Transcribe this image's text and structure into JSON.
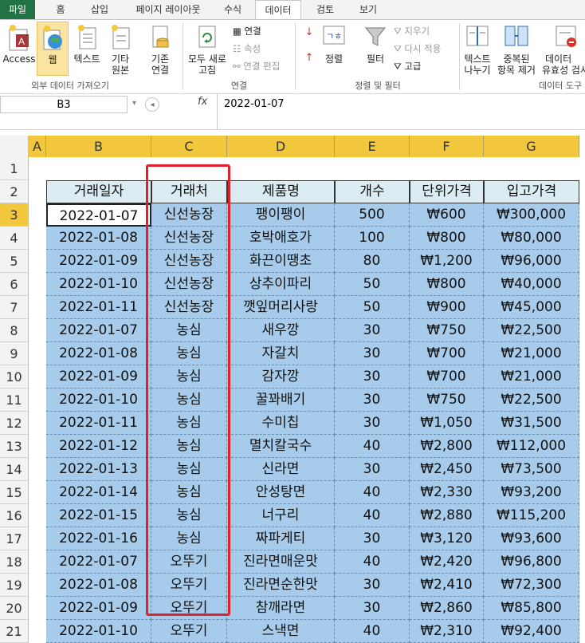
{
  "tabs": [
    "파일",
    "홈",
    "삽입",
    "페이지 레이아웃",
    "수식",
    "데이터",
    "검토",
    "보기"
  ],
  "ribbon": {
    "access": "Access",
    "web": "웹",
    "text": "텍스트",
    "other_line1": "기타",
    "other_line2": "원본",
    "existing_line1": "기존",
    "existing_line2": "연결",
    "group_external": "외부 데이터 가져오기",
    "refresh_line1": "모두 새로",
    "refresh_line2": "고침",
    "connections": "연결",
    "properties": "속성",
    "edit_links": "연결 편집",
    "group_connections": "연결",
    "sort": "정렬",
    "filter": "필터",
    "clear": "지우기",
    "reapply": "다시 적용",
    "advanced": "고급",
    "group_sort": "정렬 및 필터",
    "text_to_col_line1": "텍스트",
    "text_to_col_line2": "나누기",
    "remove_dup_line1": "중복된",
    "remove_dup_line2": "항목 제거",
    "validation_line1": "데이터",
    "validation_line2": "유효성 검사",
    "group_tools": "데이터 도구"
  },
  "formula_bar": {
    "name_box": "B3",
    "fx": "fx",
    "value": "2022-01-07"
  },
  "columns": [
    "A",
    "B",
    "C",
    "D",
    "E",
    "F",
    "G"
  ],
  "row_numbers": [
    "1",
    "2",
    "3",
    "4",
    "5",
    "6",
    "7",
    "8",
    "9",
    "10",
    "11",
    "12",
    "13",
    "14",
    "15",
    "16",
    "17",
    "18",
    "19",
    "20",
    "21"
  ],
  "headers": [
    "거래일자",
    "거래처",
    "제품명",
    "개수",
    "단위가격",
    "입고가격"
  ],
  "rows": [
    [
      "2022-01-07",
      "신선농장",
      "팽이팽이",
      "500",
      "₩600",
      "₩300,000"
    ],
    [
      "2022-01-08",
      "신선농장",
      "호박애호가",
      "100",
      "₩800",
      "₩80,000"
    ],
    [
      "2022-01-09",
      "신선농장",
      "화끈이땡초",
      "80",
      "₩1,200",
      "₩96,000"
    ],
    [
      "2022-01-10",
      "신선농장",
      "상추이파리",
      "50",
      "₩800",
      "₩40,000"
    ],
    [
      "2022-01-11",
      "신선농장",
      "깻잎머리사랑",
      "50",
      "₩900",
      "₩45,000"
    ],
    [
      "2022-01-07",
      "농심",
      "새우깡",
      "30",
      "₩750",
      "₩22,500"
    ],
    [
      "2022-01-08",
      "농심",
      "자갈치",
      "30",
      "₩700",
      "₩21,000"
    ],
    [
      "2022-01-09",
      "농심",
      "감자깡",
      "30",
      "₩700",
      "₩21,000"
    ],
    [
      "2022-01-10",
      "농심",
      "꿀꽈배기",
      "30",
      "₩750",
      "₩22,500"
    ],
    [
      "2022-01-11",
      "농심",
      "수미칩",
      "30",
      "₩1,050",
      "₩31,500"
    ],
    [
      "2022-01-12",
      "농심",
      "멸치칼국수",
      "40",
      "₩2,800",
      "₩112,000"
    ],
    [
      "2022-01-13",
      "농심",
      "신라면",
      "30",
      "₩2,450",
      "₩73,500"
    ],
    [
      "2022-01-14",
      "농심",
      "안성탕면",
      "40",
      "₩2,330",
      "₩93,200"
    ],
    [
      "2022-01-15",
      "농심",
      "너구리",
      "40",
      "₩2,880",
      "₩115,200"
    ],
    [
      "2022-01-16",
      "농심",
      "짜파게티",
      "30",
      "₩3,120",
      "₩93,600"
    ],
    [
      "2022-01-07",
      "오뚜기",
      "진라면매운맛",
      "40",
      "₩2,420",
      "₩96,800"
    ],
    [
      "2022-01-08",
      "오뚜기",
      "진라면순한맛",
      "30",
      "₩2,410",
      "₩72,300"
    ],
    [
      "2022-01-09",
      "오뚜기",
      "참깨라면",
      "30",
      "₩2,860",
      "₩85,800"
    ],
    [
      "2022-01-10",
      "오뚜기",
      "스낵면",
      "40",
      "₩2,310",
      "₩92,400"
    ]
  ]
}
